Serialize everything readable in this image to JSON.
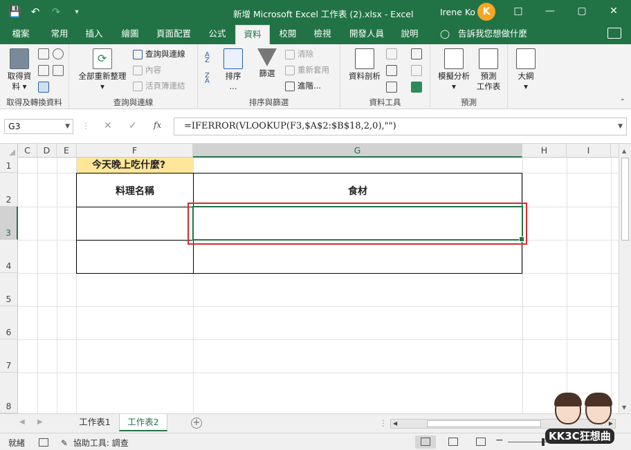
{
  "titlebar": {
    "title": "新增 Microsoft Excel 工作表 (2).xlsx  -  Excel",
    "user": "Irene Ko",
    "qat_icons": [
      "save-icon",
      "undo-icon",
      "redo-icon",
      "customize-icon"
    ],
    "window_controls": [
      "ribbon-display-icon",
      "minimize-icon",
      "maximize-icon",
      "close-icon"
    ]
  },
  "tabs": [
    "檔案",
    "常用",
    "插入",
    "繪圖",
    "頁面配置",
    "公式",
    "資料",
    "校閱",
    "檢視",
    "開發人員",
    "說明"
  ],
  "active_tab": "資料",
  "tell_me": "告訴我您想做什麼",
  "ribbon": {
    "groups": {
      "get_data": {
        "label": "取得及轉換資料",
        "get_data_btn_line1": "取得資",
        "get_data_btn_line2": "料 ▾"
      },
      "queries": {
        "label": "查詢與連線",
        "refresh_all_line1": "全部重新整理",
        "refresh_all_line2": "▾",
        "queries_connections": "查詢與連線",
        "properties": "內容",
        "edit_links": "活頁簿連結"
      },
      "sort_filter": {
        "label": "排序與篩選",
        "sort_line1": "排序",
        "sort_line2": "...",
        "filter": "篩選",
        "clear": "清除",
        "reapply": "重新套用",
        "advanced": "進階..."
      },
      "data_tools": {
        "label": "資料工具",
        "text_to_columns": "資料剖析"
      },
      "forecast": {
        "label": "預測",
        "what_if_line1": "模擬分析",
        "what_if_line2": "▾",
        "forecast_sheet_line1": "預測",
        "forecast_sheet_line2": "工作表"
      },
      "outline": {
        "outline_line1": "大綱",
        "outline_line2": "▾"
      }
    }
  },
  "formula_bar": {
    "name_box": "G3",
    "formula": "=IFERROR(VLOOKUP(F3,$A$2:$B$18,2,0),\"\")"
  },
  "grid": {
    "columns": [
      "C",
      "D",
      "E",
      "F",
      "G",
      "H",
      "I"
    ],
    "selected_column": "G",
    "rows": [
      "1",
      "2",
      "3",
      "4",
      "5",
      "6",
      "7",
      "8"
    ],
    "selected_row": "3",
    "cells": {
      "F1": "今天晚上吃什麼?",
      "F2": "料理名稱",
      "G2": "食材"
    },
    "title_fill": "#ffe699",
    "highlight_color": "#d62b2b"
  },
  "sheets": [
    "工作表1",
    "工作表2"
  ],
  "active_sheet": "工作表2",
  "status": {
    "ready": "就緒",
    "accessibility": "協助工具: 調查"
  },
  "watermark": "KK3C狂想曲",
  "colors": {
    "accent": "#217346",
    "ribbon_bg": "#f3f3f3"
  }
}
